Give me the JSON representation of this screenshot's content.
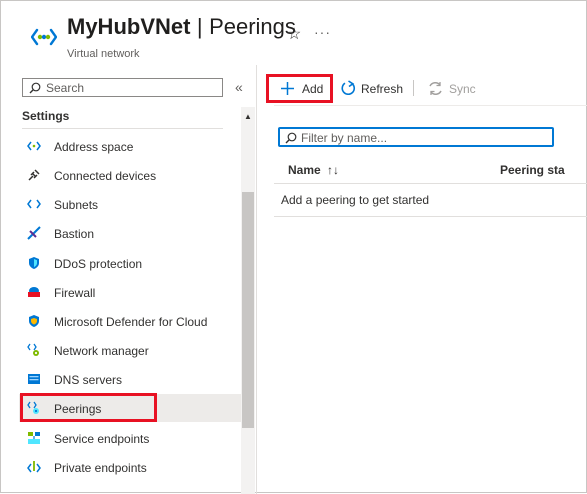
{
  "header": {
    "resource_name": "MyHubVNet",
    "separator": "|",
    "blade_name": "Peerings",
    "subtitle": "Virtual network",
    "favorite_icon": "star-icon",
    "more_label": "···"
  },
  "sidebar": {
    "search_placeholder": "Search",
    "collapse_label": "«",
    "section_label": "Settings",
    "items": [
      {
        "label": "Address space",
        "icon": "address-space-icon"
      },
      {
        "label": "Connected devices",
        "icon": "plug-icon"
      },
      {
        "label": "Subnets",
        "icon": "subnets-icon"
      },
      {
        "label": "Bastion",
        "icon": "bastion-icon"
      },
      {
        "label": "DDoS protection",
        "icon": "shield-icon"
      },
      {
        "label": "Firewall",
        "icon": "firewall-icon"
      },
      {
        "label": "Microsoft Defender for Cloud",
        "icon": "defender-icon"
      },
      {
        "label": "Network manager",
        "icon": "network-manager-icon"
      },
      {
        "label": "DNS servers",
        "icon": "dns-icon"
      },
      {
        "label": "Peerings",
        "icon": "peerings-icon",
        "active": true
      },
      {
        "label": "Service endpoints",
        "icon": "service-endpoints-icon"
      },
      {
        "label": "Private endpoints",
        "icon": "private-endpoints-icon"
      }
    ]
  },
  "toolbar": {
    "add_label": "Add",
    "refresh_label": "Refresh",
    "sync_label": "Sync"
  },
  "main": {
    "filter_placeholder": "Filter by name...",
    "columns": [
      "Name",
      "Peering sta"
    ],
    "sort_indicator": "↑↓",
    "empty_message": "Add a peering to get started"
  },
  "colors": {
    "accent": "#0078d4",
    "highlight": "#e81123",
    "active_bg": "#edebe9"
  }
}
